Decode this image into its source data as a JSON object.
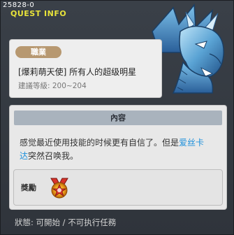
{
  "header": {
    "quest_id": "25828-0",
    "title": "QUEST INFO"
  },
  "job": {
    "badge": "職業"
  },
  "quest": {
    "name": "[爆莉萌天使] 所有人的超级明星",
    "level": "建議等級: 200~204"
  },
  "content": {
    "section_title": "內容",
    "desc_part1": "感觉最近使用技能的时候更有自信了。但是",
    "desc_highlight_1": "爱丝卡",
    "desc_highlight_2": "达",
    "desc_part2": "突然召唤我。"
  },
  "reward": {
    "label": "獎勵",
    "icon": "medal-icon"
  },
  "status": {
    "text": "狀態:  可開始 / 不可执行任務"
  },
  "icons": {
    "portrait": "dragon-portrait-icon",
    "reward": "medal-icon"
  },
  "colors": {
    "title_yellow": "#e8e33a",
    "highlight_blue": "#1c8fdb",
    "badge_tan": "#b79870"
  }
}
